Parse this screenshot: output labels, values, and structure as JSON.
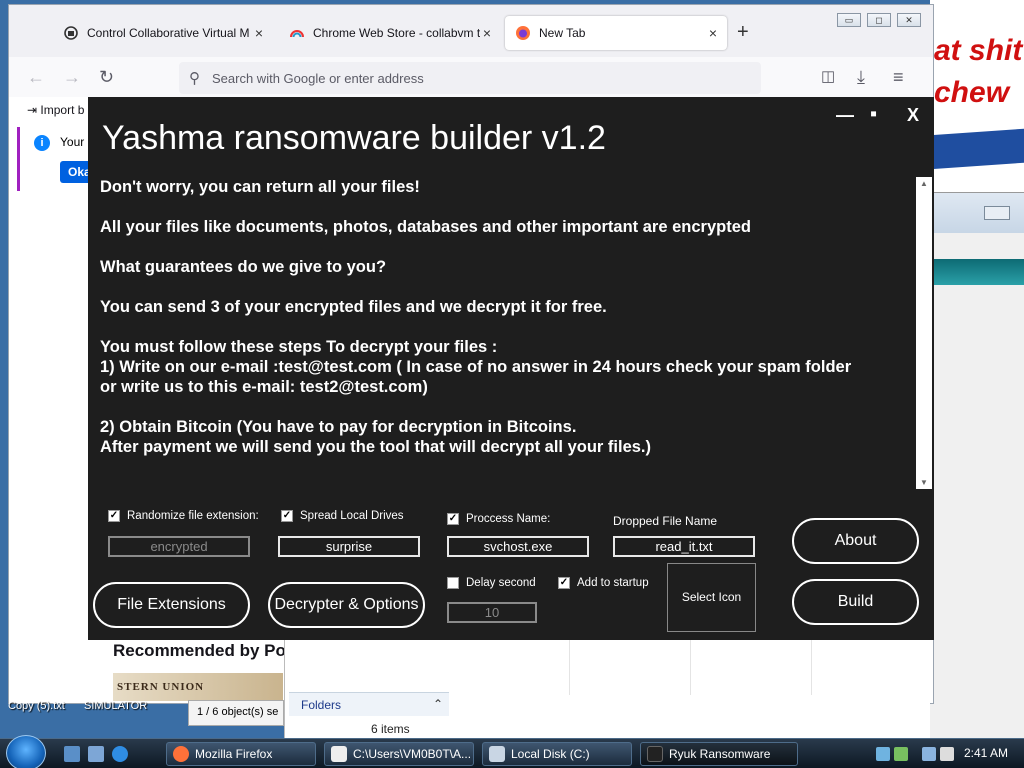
{
  "background": {
    "banner_line1": "at shit",
    "banner_line2": "chew"
  },
  "firefox": {
    "tabs": [
      {
        "label": "Control Collaborative Virtual M",
        "close": "×"
      },
      {
        "label": "Chrome Web Store - collabvm t",
        "close": "×"
      },
      {
        "label": "New Tab",
        "close": "×"
      }
    ],
    "new_tab": "+",
    "address_placeholder": "Search with Google or enter address",
    "import_label": "Import b",
    "notice_text": "Your p",
    "notice_button": "Oka",
    "recommended": "Recommended by Po",
    "western_union": "STERN UNION"
  },
  "explorer": {
    "folders": "Folders",
    "items": "6 items",
    "status": "1 / 6 object(s) se",
    "desk_left": "Copy (5).txt",
    "desk_mid": "SIMULATOR"
  },
  "yashma": {
    "title": "Yashma ransomware builder v1.2",
    "minimize": "—",
    "maximize": "▪",
    "close": "X",
    "message": "Don't worry, you can return all your files!\n\nAll your files like documents, photos, databases and other important are encrypted\n\nWhat guarantees do we give to you?\n\nYou can send 3 of your encrypted files and we decrypt it for free.\n\nYou must follow these steps To decrypt your files :\n1) Write on our e-mail :test@test.com ( In case of no answer in 24 hours check your spam folder\nor write us to this e-mail: test2@test.com)\n\n2) Obtain Bitcoin (You have to pay for decryption in Bitcoins.\nAfter payment we will send you the tool that will decrypt all your files.)",
    "randomize_label": "Randomize file extension:",
    "randomize_checked": true,
    "randomize_value": "encrypted",
    "spread_label": "Spread Local Drives",
    "spread_checked": true,
    "spread_value": "surprise",
    "process_label": "Proccess Name:",
    "process_checked": true,
    "process_value": "svchost.exe",
    "dropped_label": "Dropped File Name",
    "dropped_value": "read_it.txt",
    "delay_label": "Delay second",
    "delay_checked": false,
    "delay_value": "10",
    "startup_label": "Add to startup",
    "startup_checked": true,
    "select_icon": "Select Icon",
    "about": "About",
    "build": "Build",
    "file_extensions": "File Extensions",
    "decrypter_options": "Decrypter & Options"
  },
  "taskbar": {
    "buttons": [
      {
        "label": "Mozilla Firefox"
      },
      {
        "label": "C:\\Users\\VM0B0T\\A..."
      },
      {
        "label": "Local Disk (C:)"
      },
      {
        "label": "Ryuk Ransomware"
      }
    ],
    "clock": "2:41 AM"
  },
  "colors": {
    "builder_bg": "#1e1e1e",
    "taskbar": "#1c2c3d",
    "firefox_chrome": "#f0f0f4"
  }
}
